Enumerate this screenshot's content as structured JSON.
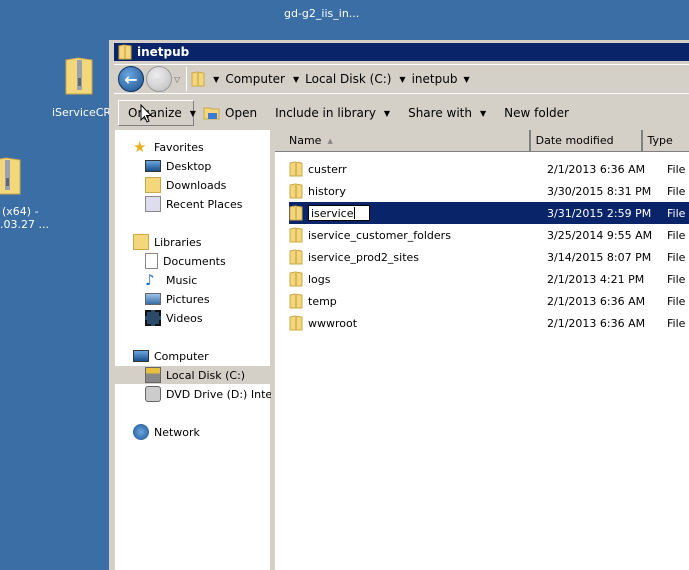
{
  "desktop": {
    "icons": [
      {
        "label": "gd-g2_iis_in...",
        "icon": "zip-folder-icon"
      },
      {
        "label": "iServiceCRM",
        "icon": "zip-folder-icon"
      },
      {
        "label_line1": "(x64) -",
        "label_line2": ".03.27 ...",
        "icon": "zip-folder-icon"
      }
    ]
  },
  "window": {
    "title": "inetpub",
    "address": {
      "crumbs": [
        "Computer",
        "Local Disk (C:)",
        "inetpub"
      ]
    },
    "toolbar": {
      "organize": "Organize",
      "open": "Open",
      "include_in_library": "Include in library",
      "share_with": "Share with",
      "new_folder": "New folder"
    },
    "nav": {
      "favorites": "Favorites",
      "desktop": "Desktop",
      "downloads": "Downloads",
      "recent_places": "Recent Places",
      "libraries": "Libraries",
      "documents": "Documents",
      "music": "Music",
      "pictures": "Pictures",
      "videos": "Videos",
      "computer": "Computer",
      "local_disk": "Local Disk (C:)",
      "dvd_drive": "DVD Drive (D:) Integra",
      "network": "Network"
    },
    "columns": {
      "name": "Name",
      "date_modified": "Date modified",
      "type": "Type"
    },
    "files": [
      {
        "name": "custerr",
        "date": "2/1/2013 6:36 AM",
        "type": "File"
      },
      {
        "name": "history",
        "date": "3/30/2015 8:31 PM",
        "type": "File"
      },
      {
        "name": "iservice",
        "date": "3/31/2015 2:59 PM",
        "type": "File",
        "renaming": true
      },
      {
        "name": "iservice_customer_folders",
        "date": "3/25/2014 9:55 AM",
        "type": "File"
      },
      {
        "name": "iservice_prod2_sites",
        "date": "3/14/2015 8:07 PM",
        "type": "File"
      },
      {
        "name": "logs",
        "date": "2/1/2013 4:21 PM",
        "type": "File"
      },
      {
        "name": "temp",
        "date": "2/1/2013 6:36 AM",
        "type": "File"
      },
      {
        "name": "wwwroot",
        "date": "2/1/2013 6:36 AM",
        "type": "File"
      }
    ]
  }
}
